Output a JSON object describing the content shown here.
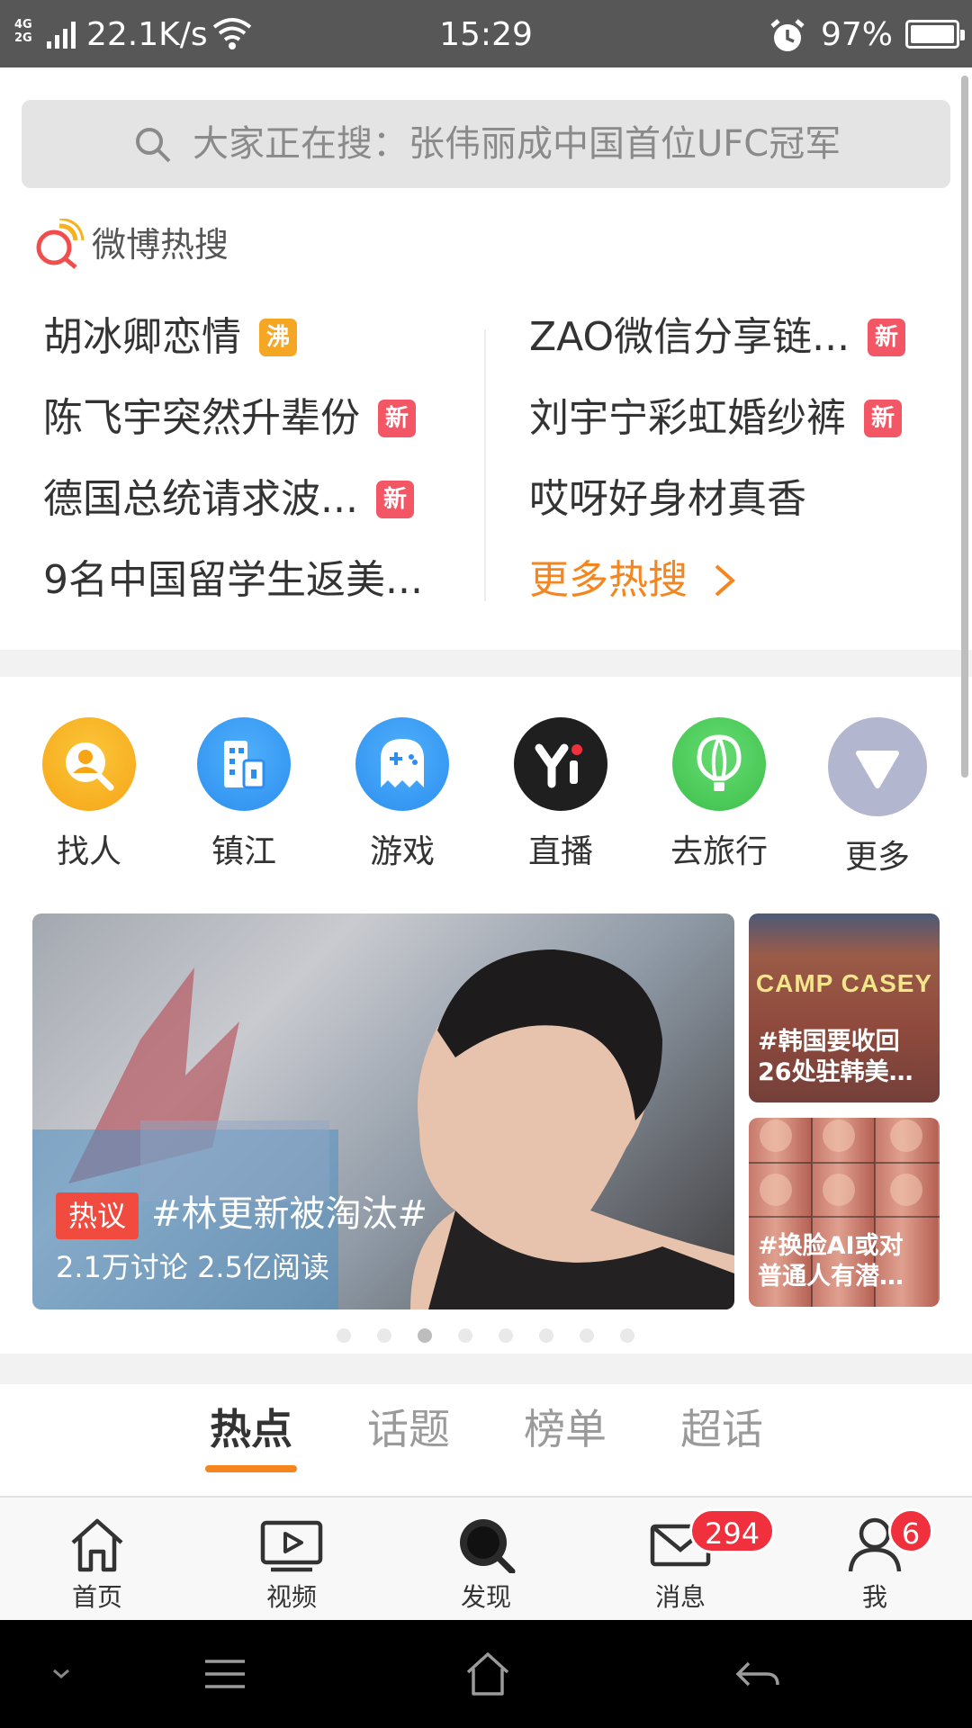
{
  "status_bar": {
    "network": "4G\n2G",
    "speed": "22.1K/s",
    "time": "15:29",
    "battery": "97%",
    "icons": [
      "signal-icon",
      "wifi-icon",
      "alarm-icon",
      "battery-icon"
    ]
  },
  "search": {
    "placeholder": "大家正在搜：张伟丽成中国首位UFC冠军",
    "icon": "search-icon"
  },
  "hot_search": {
    "title": "微博热搜",
    "left": [
      {
        "text": "胡冰卿恋情",
        "badge": "沸"
      },
      {
        "text": "陈飞宇突然升辈份",
        "badge": "新"
      },
      {
        "text": "德国总统请求波...",
        "badge": "新"
      },
      {
        "text": "9名中国留学生返美...",
        "badge": ""
      }
    ],
    "right": [
      {
        "text": "ZAO微信分享链...",
        "badge": "新"
      },
      {
        "text": "刘宇宁彩虹婚纱裤",
        "badge": "新"
      },
      {
        "text": "哎呀好身材真香",
        "badge": ""
      },
      {
        "text": "更多热搜",
        "badge": ""
      }
    ],
    "accent_color": "#f5861f"
  },
  "categories": [
    {
      "label": "找人",
      "icon": "find-people-icon",
      "color": "#f9b324"
    },
    {
      "label": "镇江",
      "icon": "city-building-icon",
      "color": "#3a9df5"
    },
    {
      "label": "游戏",
      "icon": "game-ghost-icon",
      "color": "#3a9df5"
    },
    {
      "label": "直播",
      "icon": "yi-live-icon",
      "color": "#222222"
    },
    {
      "label": "去旅行",
      "icon": "balloon-icon",
      "color": "#4ccf5a"
    },
    {
      "label": "更多",
      "icon": "more-triangle-icon",
      "color": "#b3b6cf"
    }
  ],
  "banner": {
    "tag": "热议",
    "topic": "#林更新被淘汰#",
    "stats": "2.1万讨论  2.5亿阅读"
  },
  "side_cards": [
    {
      "sign": "CAMP CASEY",
      "caption": "#韩国要收回\n26处驻韩美…"
    },
    {
      "caption": "#换脸AI或对\n普通人有潜…"
    }
  ],
  "carousel": {
    "count": 8,
    "active": 3
  },
  "tabs": [
    {
      "label": "热点",
      "active": true
    },
    {
      "label": "话题",
      "active": false
    },
    {
      "label": "榜单",
      "active": false
    },
    {
      "label": "超话",
      "active": false
    }
  ],
  "tabbar": [
    {
      "label": "首页",
      "icon": "home-icon",
      "badge": ""
    },
    {
      "label": "视频",
      "icon": "video-icon",
      "badge": ""
    },
    {
      "label": "发现",
      "icon": "discover-icon",
      "badge": ""
    },
    {
      "label": "消息",
      "icon": "mail-icon",
      "badge": "294"
    },
    {
      "label": "我",
      "icon": "profile-icon",
      "badge": "6"
    }
  ]
}
